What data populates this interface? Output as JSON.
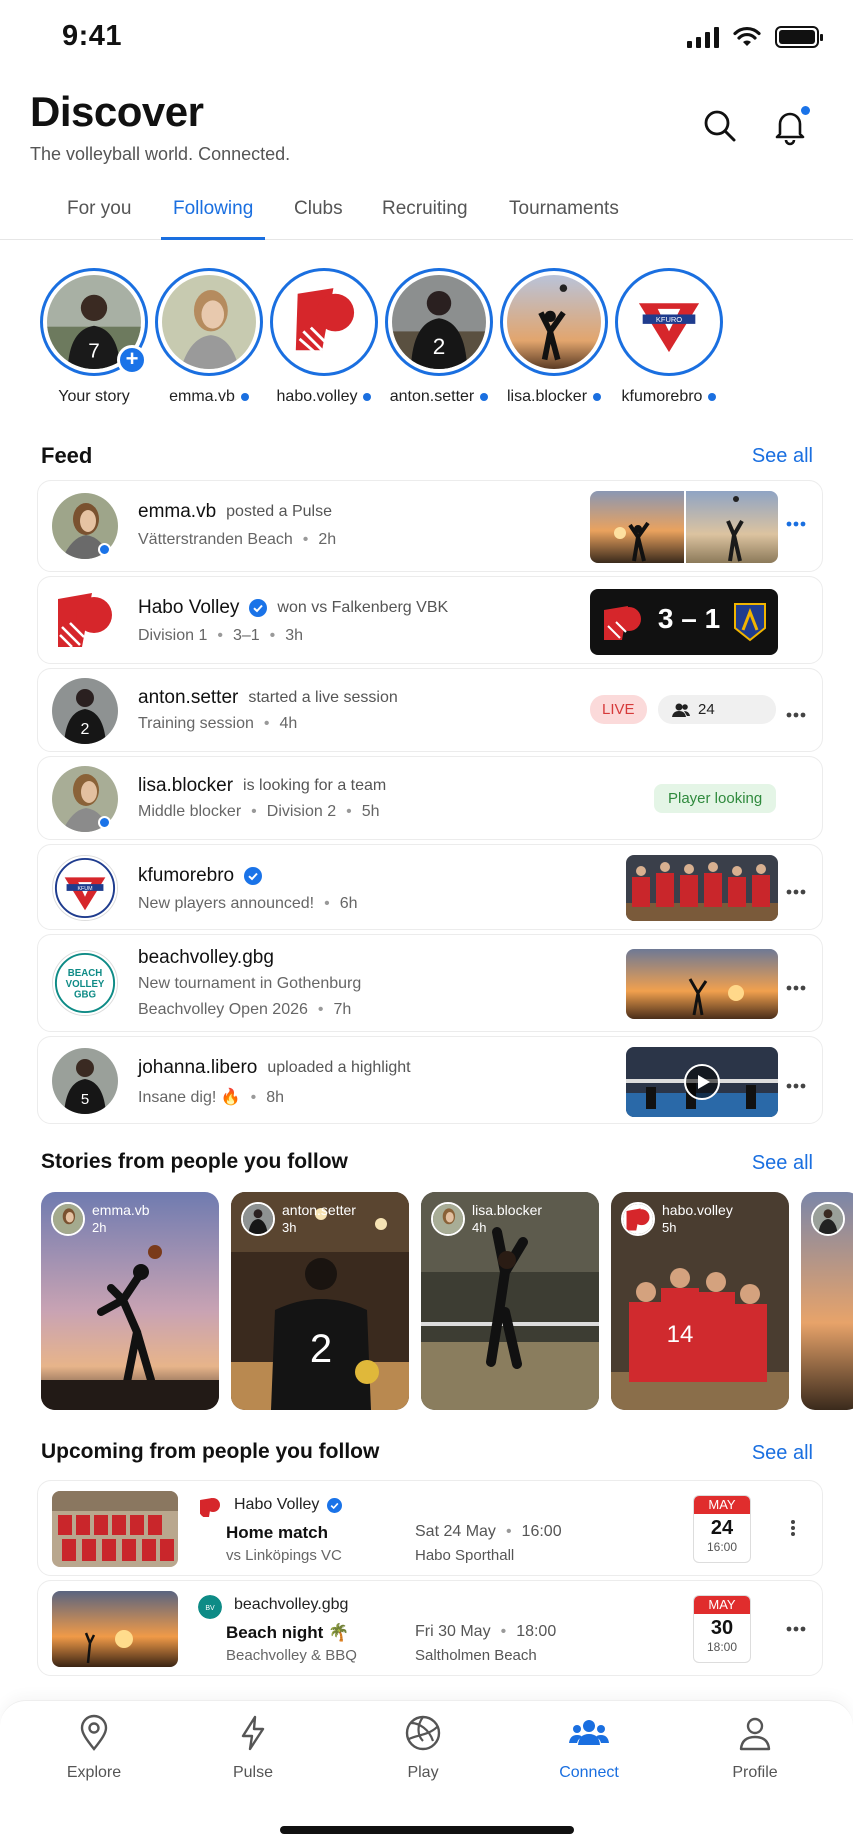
{
  "status_bar": {
    "time": "9:41"
  },
  "header": {
    "title": "Discover",
    "subtitle": "The volleyball world. Connected."
  },
  "tabs": [
    {
      "label": "For you",
      "active": false
    },
    {
      "label": "Following",
      "active": true
    },
    {
      "label": "Clubs",
      "active": false
    },
    {
      "label": "Recruiting",
      "active": false
    },
    {
      "label": "Tournaments",
      "active": false
    }
  ],
  "stories": [
    {
      "name": "Your story",
      "is_self": true
    },
    {
      "name": "emma.vb"
    },
    {
      "name": "habo.volley"
    },
    {
      "name": "anton.setter"
    },
    {
      "name": "lisa.blocker"
    },
    {
      "name": "kfumorebro"
    }
  ],
  "feed": {
    "title": "Feed",
    "see_all": "See all",
    "items": [
      {
        "user": "emma.vb",
        "action": "posted a Pulse",
        "detail": "Vätterstranden Beach",
        "time": "2h"
      },
      {
        "user": "Habo Volley",
        "action": "won vs Falkenberg VBK",
        "detail": "Division 1",
        "detail2": "3–1",
        "time": "3h",
        "score": "3 – 1"
      },
      {
        "user": "anton.setter",
        "action": "started a live session",
        "detail": "Training session",
        "time": "4h",
        "live": "LIVE",
        "viewers": "24"
      },
      {
        "user": "lisa.blocker",
        "action": "is looking for a team",
        "detail": "Middle blocker",
        "detail2": "Division 2",
        "time": "5h",
        "badge": "Player looking"
      },
      {
        "user": "kfumorebro",
        "action": "",
        "detail": "New players announced!",
        "time": "6h"
      },
      {
        "user": "beachvolley.gbg",
        "action": "",
        "detail": "New tournament in Gothenburg",
        "detail2": "Beachvolley Open 2026",
        "time": "7h"
      },
      {
        "user": "johanna.libero",
        "action": "uploaded a highlight",
        "detail": "Insane dig! 🔥",
        "time": "8h"
      }
    ]
  },
  "stories_section": {
    "title": "Stories from people you follow",
    "see_all": "See all",
    "cards": [
      {
        "name": "emma.vb",
        "time": "2h"
      },
      {
        "name": "anton.setter",
        "time": "3h"
      },
      {
        "name": "lisa.blocker",
        "time": "4h"
      },
      {
        "name": "habo.volley",
        "time": "5h"
      }
    ]
  },
  "upcoming": {
    "title": "Upcoming from people you follow",
    "see_all": "See all",
    "items": [
      {
        "org": "Habo Volley",
        "title": "Home match",
        "sub": "vs Linköpings VC",
        "date": "Sat 24 May",
        "time": "16:00",
        "venue": "Habo Sporthall",
        "cal_month": "MAY",
        "cal_day": "24",
        "cal_time": "16:00"
      },
      {
        "org": "beachvolley.gbg",
        "title": "Beach night 🌴",
        "sub": "Beachvolley & BBQ",
        "date": "Fri 30 May",
        "time": "18:00",
        "venue": "Saltholmen Beach",
        "cal_month": "MAY",
        "cal_day": "30",
        "cal_time": "18:00"
      }
    ]
  },
  "nav": [
    {
      "label": "Explore",
      "icon": "map-pin-icon",
      "active": false
    },
    {
      "label": "Pulse",
      "icon": "lightning-icon",
      "active": false
    },
    {
      "label": "Play",
      "icon": "volleyball-icon",
      "active": false
    },
    {
      "label": "Connect",
      "icon": "people-icon",
      "active": true
    },
    {
      "label": "Profile",
      "icon": "person-icon",
      "active": false
    }
  ],
  "colors": {
    "accent": "#1a6fe0",
    "live": "#d63a3a",
    "club_red": "#e02d2d"
  }
}
